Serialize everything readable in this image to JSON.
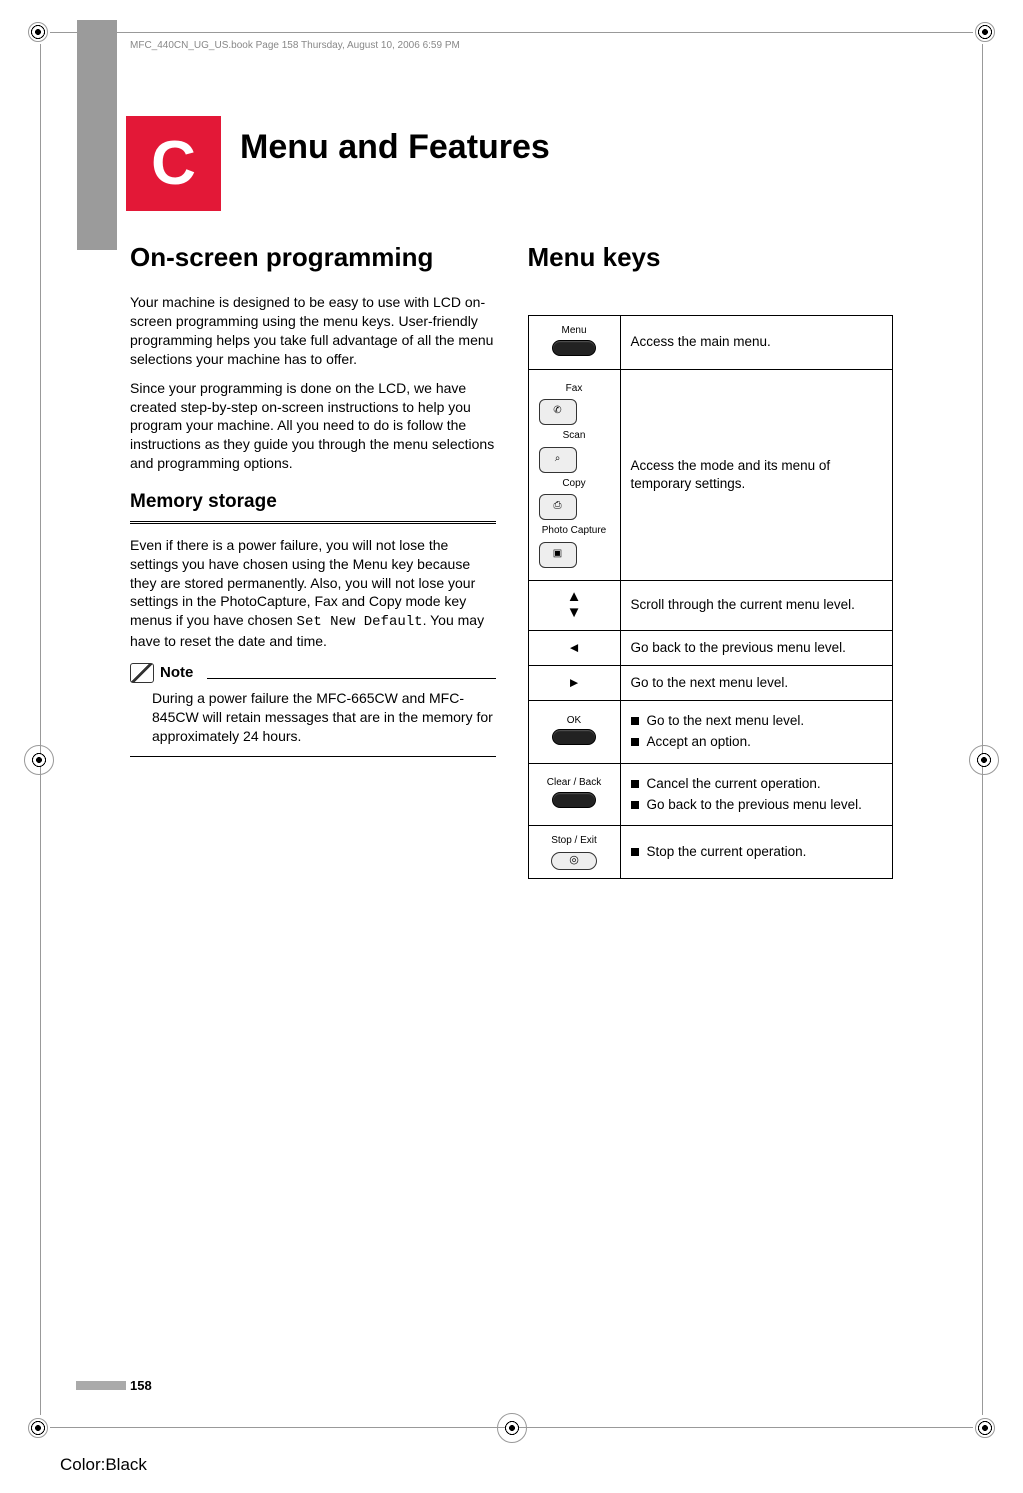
{
  "header_line": "MFC_440CN_UG_US.book  Page 158  Thursday, August 10, 2006  6:59 PM",
  "appendix_letter": "C",
  "appendix_title": "Menu and Features",
  "left": {
    "h2": "On-screen programming",
    "p1": "Your machine is designed to be easy to use with LCD on-screen programming using the menu keys. User-friendly programming helps you take full advantage of all the menu selections your machine has to offer.",
    "p2": "Since your programming is done on the LCD, we have created step-by-step on-screen instructions to help you program your machine. All you need to do is follow the instructions as they guide you through the menu selections and programming options.",
    "h3": "Memory storage",
    "p3a": "Even if there is a power failure, you will not lose the settings you have chosen using the Menu key because they are stored permanently. Also, you will not lose your settings in the PhotoCapture, Fax and Copy mode key menus if you have chosen ",
    "p3_code": "Set New Default",
    "p3b": ". You may have to reset the date and time.",
    "note_label": "Note",
    "note_body": "During a power failure the MFC-665CW and MFC-845CW will retain messages that are in the memory for approximately 24 hours."
  },
  "right": {
    "h2": "Menu keys",
    "row1": {
      "label": "Menu",
      "desc": "Access the main menu."
    },
    "row2": {
      "labels": {
        "fax": "Fax",
        "scan": "Scan",
        "copy": "Copy",
        "photo": "Photo Capture"
      },
      "desc": "Access the mode and its menu of temporary settings."
    },
    "row3": {
      "desc": "Scroll through the current menu level."
    },
    "row4": {
      "desc": "Go back to the previous menu level."
    },
    "row5": {
      "desc": "Go to the next menu level."
    },
    "row6": {
      "label": "OK",
      "li1": "Go to the next menu level.",
      "li2": "Accept an option."
    },
    "row7": {
      "label": "Clear / Back",
      "li1": "Cancel the current operation.",
      "li2": "Go back to the previous menu level."
    },
    "row8": {
      "label": "Stop / Exit",
      "li1": "Stop the current operation."
    }
  },
  "page_number": "158",
  "color_label": "Color:Black"
}
